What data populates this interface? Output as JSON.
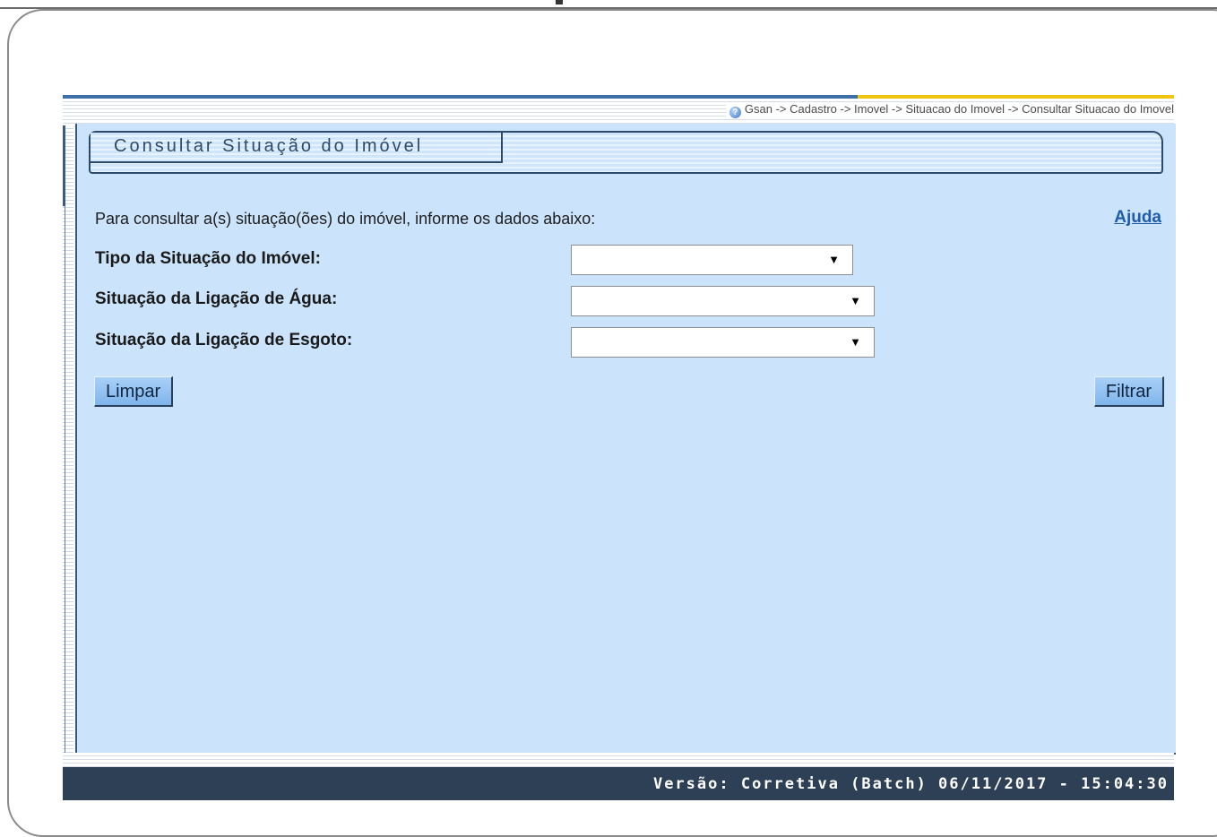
{
  "breadcrumb": {
    "text": "Gsan -> Cadastro -> Imovel -> Situacao do Imovel -> Consultar Situacao do Imovel",
    "icon": "help-circle-icon"
  },
  "page": {
    "title": "Consultar Situação do Imóvel",
    "intro": "Para consultar a(s) situação(ões) do imóvel, informe os dados abaixo:",
    "help_link": "Ajuda"
  },
  "form": {
    "fields": [
      {
        "label": "Tipo da Situação do Imóvel:",
        "value": ""
      },
      {
        "label": "Situação da Ligação de Água:",
        "value": ""
      },
      {
        "label": "Situação da Ligação de Esgoto:",
        "value": ""
      }
    ],
    "clear_label": "Limpar",
    "filter_label": "Filtrar"
  },
  "footer": {
    "version": "Versão: Corretiva (Batch) 06/11/2017 - 15:04:30"
  },
  "colors": {
    "panel_bg": "#cce4fb",
    "header_blue": "#3d6ea8",
    "header_yellow": "#f1c40f",
    "footer_bg": "#2e4056",
    "link": "#1f5dab"
  }
}
